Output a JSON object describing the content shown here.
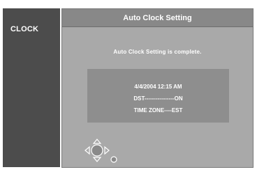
{
  "sidebar": {
    "label": "CLOCK"
  },
  "dialog": {
    "title": "Auto Clock Setting",
    "message": "Auto Clock Setting is complete.",
    "info": {
      "datetime": "4/4/2004 12:15 AM",
      "dst": "DST----------------ON",
      "timezone": "TIME ZONE----EST"
    }
  },
  "icons": {
    "navigation": "directional-pad-icon",
    "ok": "enter-dot-icon"
  }
}
